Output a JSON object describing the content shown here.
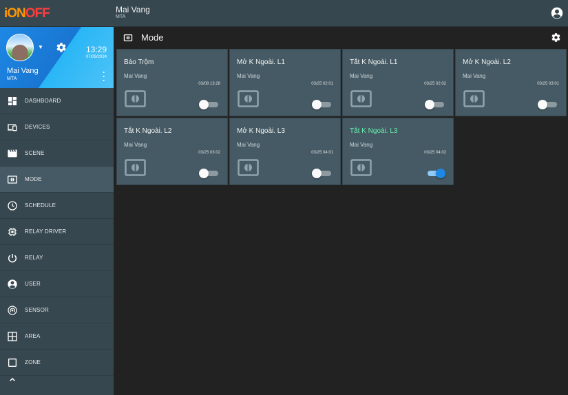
{
  "app": {
    "logo_part1": "iON",
    "logo_part2": "OFF",
    "user_name": "Mai Vang",
    "user_sub": "MTA"
  },
  "profile": {
    "time": "13:29",
    "date": "07/09/2024",
    "name": "Mai Vang",
    "sub": "MTA"
  },
  "nav": [
    {
      "label": "DASHBOARD",
      "icon": "dashboard-icon"
    },
    {
      "label": "DEVICES",
      "icon": "devices-icon"
    },
    {
      "label": "SCENE",
      "icon": "scene-clapper-icon"
    },
    {
      "label": "MODE",
      "icon": "mode-icon",
      "active": true
    },
    {
      "label": "SCHEDULE",
      "icon": "clock-icon"
    },
    {
      "label": "RELAY DRIVER",
      "icon": "chip-icon"
    },
    {
      "label": "RELAY",
      "icon": "power-icon"
    },
    {
      "label": "USER",
      "icon": "user-circle-icon"
    },
    {
      "label": "SENSOR",
      "icon": "sensor-icon"
    },
    {
      "label": "AREA",
      "icon": "area-grid-icon"
    },
    {
      "label": "ZONE",
      "icon": "zone-square-icon"
    }
  ],
  "page": {
    "title": "Mode"
  },
  "modes": [
    {
      "title": "Báo Trộm",
      "owner": "Mai Vang",
      "date": "03/08 13:28",
      "on": false,
      "highlight": false
    },
    {
      "title": "Mở K Ngoài. L1",
      "owner": "Mai Vang",
      "date": "03/25 02:01",
      "on": false,
      "highlight": false
    },
    {
      "title": "Tắt K Ngoài. L1",
      "owner": "Mai Vang",
      "date": "03/25 02:02",
      "on": false,
      "highlight": false
    },
    {
      "title": "Mở K Ngoài. L2",
      "owner": "Mai Vang",
      "date": "03/25 03:01",
      "on": false,
      "highlight": false
    },
    {
      "title": "Tắt K Ngoài. L2",
      "owner": "Mai Vang",
      "date": "03/25 03:02",
      "on": false,
      "highlight": false
    },
    {
      "title": "Mở K Ngoài. L3",
      "owner": "Mai Vang",
      "date": "03/25 04:01",
      "on": false,
      "highlight": false
    },
    {
      "title": "Tắt K Ngoài. L3",
      "owner": "Mai Vang",
      "date": "03/25 04:02",
      "on": true,
      "highlight": true
    }
  ],
  "colors": {
    "accent": "#1e88e5",
    "highlight_text": "#69f0ae",
    "card_bg": "#455a64",
    "sidebar_bg": "#37474f",
    "main_bg": "#222222"
  }
}
